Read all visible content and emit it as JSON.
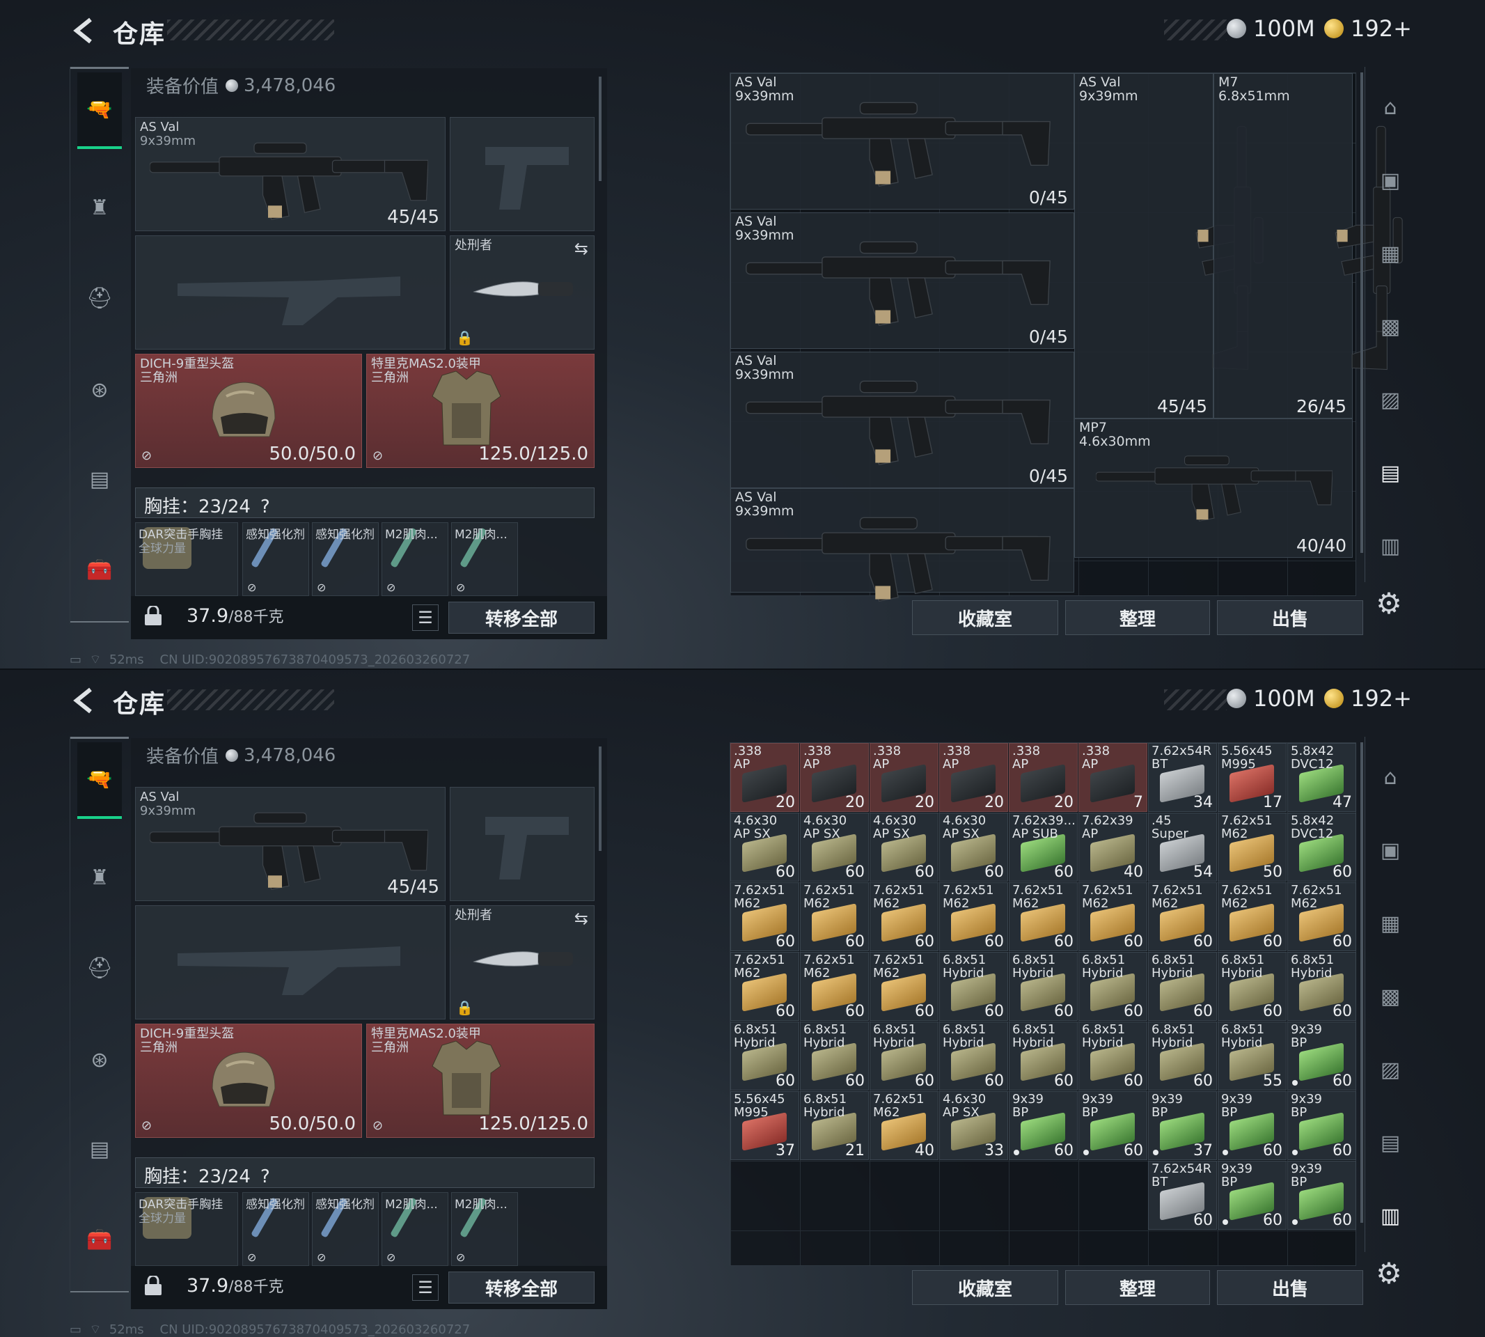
{
  "header": {
    "title": "仓库",
    "silver": "100M",
    "gold": "192+"
  },
  "status": {
    "ping": "52ms",
    "uid": "CN UID:9020895767387040957​3_202603260727"
  },
  "loadout": {
    "value_label": "装备价值",
    "value": "3,478,046",
    "primary": {
      "name": "AS Val",
      "caliber": "9x39mm",
      "ammo": "45/45"
    },
    "melee": {
      "name": "处刑者"
    },
    "helmet": {
      "name": "DICH-9重型头盔",
      "sub": "三角洲",
      "dur": "50.0/50.0"
    },
    "armor": {
      "name": "特里克MAS2.0装甲",
      "sub": "三角洲",
      "dur": "125.0/125.0"
    },
    "chest": {
      "label": "胸挂：23/24",
      "help": "?"
    },
    "chest_items": [
      "DAR突击手胸挂",
      "感知强化剂",
      "感知强化剂",
      "M2肌肉...",
      "M2肌肉..."
    ],
    "chest_item_sub": "全球力量",
    "weight": "37.9",
    "weight_max": "/88千克",
    "transfer_all": "转移全部"
  },
  "buttons": {
    "collection": "收藏室",
    "sort": "整理",
    "sell": "出售"
  },
  "stash1": [
    {
      "name": "AS Val",
      "cal": "9x39mm",
      "count": "0/45"
    },
    {
      "name": "AS Val",
      "cal": "9x39mm",
      "count": "0/45"
    },
    {
      "name": "AS Val",
      "cal": "9x39mm",
      "count": "0/45"
    },
    {
      "name": "AS Val",
      "cal": "9x39mm",
      "count": ""
    },
    {
      "name": "AS Val",
      "cal": "9x39mm",
      "count": "45/45"
    },
    {
      "name": "M7",
      "cal": "6.8x51mm",
      "count": "26/45"
    },
    {
      "name": "MP7",
      "cal": "4.6x30mm",
      "count": "40/40"
    }
  ],
  "ammo": [
    {
      "n1": ".338",
      "n2": "AP",
      "c": "20",
      "k": "dark",
      "red": true
    },
    {
      "n1": ".338",
      "n2": "AP",
      "c": "20",
      "k": "dark",
      "red": true
    },
    {
      "n1": ".338",
      "n2": "AP",
      "c": "20",
      "k": "dark",
      "red": true
    },
    {
      "n1": ".338",
      "n2": "AP",
      "c": "20",
      "k": "dark",
      "red": true
    },
    {
      "n1": ".338",
      "n2": "AP",
      "c": "20",
      "k": "dark",
      "red": true
    },
    {
      "n1": ".338",
      "n2": "AP",
      "c": "7",
      "k": "dark",
      "red": true
    },
    {
      "n1": "7.62x54R",
      "n2": "BT",
      "c": "34",
      "k": "grey"
    },
    {
      "n1": "5.56x45",
      "n2": "M995",
      "c": "17",
      "k": "redb"
    },
    {
      "n1": "5.8x42",
      "n2": "DVC12",
      "c": "47",
      "k": "green"
    },
    {
      "n1": "4.6x30",
      "n2": "AP SX",
      "c": "60",
      "k": "olive"
    },
    {
      "n1": "4.6x30",
      "n2": "AP SX",
      "c": "60",
      "k": "olive"
    },
    {
      "n1": "4.6x30",
      "n2": "AP SX",
      "c": "60",
      "k": "olive"
    },
    {
      "n1": "4.6x30",
      "n2": "AP SX",
      "c": "60",
      "k": "olive"
    },
    {
      "n1": "7.62x39...",
      "n2": "AP SUB",
      "c": "60",
      "k": "green"
    },
    {
      "n1": "7.62x39",
      "n2": "AP",
      "c": "40",
      "k": "olive"
    },
    {
      "n1": ".45",
      "n2": "Super",
      "c": "54",
      "k": "grey"
    },
    {
      "n1": "7.62x51",
      "n2": "M62",
      "c": "50",
      "k": "gold"
    },
    {
      "n1": "5.8x42",
      "n2": "DVC12",
      "c": "60",
      "k": "green"
    },
    {
      "n1": "7.62x51",
      "n2": "M62",
      "c": "60",
      "k": "gold"
    },
    {
      "n1": "7.62x51",
      "n2": "M62",
      "c": "60",
      "k": "gold"
    },
    {
      "n1": "7.62x51",
      "n2": "M62",
      "c": "60",
      "k": "gold"
    },
    {
      "n1": "7.62x51",
      "n2": "M62",
      "c": "60",
      "k": "gold"
    },
    {
      "n1": "7.62x51",
      "n2": "M62",
      "c": "60",
      "k": "gold"
    },
    {
      "n1": "7.62x51",
      "n2": "M62",
      "c": "60",
      "k": "gold"
    },
    {
      "n1": "7.62x51",
      "n2": "M62",
      "c": "60",
      "k": "gold"
    },
    {
      "n1": "7.62x51",
      "n2": "M62",
      "c": "60",
      "k": "gold"
    },
    {
      "n1": "7.62x51",
      "n2": "M62",
      "c": "60",
      "k": "gold"
    },
    {
      "n1": "7.62x51",
      "n2": "M62",
      "c": "60",
      "k": "gold"
    },
    {
      "n1": "7.62x51",
      "n2": "M62",
      "c": "60",
      "k": "gold"
    },
    {
      "n1": "7.62x51",
      "n2": "M62",
      "c": "60",
      "k": "gold"
    },
    {
      "n1": "6.8x51",
      "n2": "Hybrid",
      "c": "60",
      "k": "olive"
    },
    {
      "n1": "6.8x51",
      "n2": "Hybrid",
      "c": "60",
      "k": "olive"
    },
    {
      "n1": "6.8x51",
      "n2": "Hybrid",
      "c": "60",
      "k": "olive"
    },
    {
      "n1": "6.8x51",
      "n2": "Hybrid",
      "c": "60",
      "k": "olive"
    },
    {
      "n1": "6.8x51",
      "n2": "Hybrid",
      "c": "60",
      "k": "olive"
    },
    {
      "n1": "6.8x51",
      "n2": "Hybrid",
      "c": "60",
      "k": "olive"
    },
    {
      "n1": "6.8x51",
      "n2": "Hybrid",
      "c": "60",
      "k": "olive"
    },
    {
      "n1": "6.8x51",
      "n2": "Hybrid",
      "c": "60",
      "k": "olive"
    },
    {
      "n1": "6.8x51",
      "n2": "Hybrid",
      "c": "60",
      "k": "olive"
    },
    {
      "n1": "6.8x51",
      "n2": "Hybrid",
      "c": "60",
      "k": "olive"
    },
    {
      "n1": "6.8x51",
      "n2": "Hybrid",
      "c": "60",
      "k": "olive"
    },
    {
      "n1": "6.8x51",
      "n2": "Hybrid",
      "c": "60",
      "k": "olive"
    },
    {
      "n1": "6.8x51",
      "n2": "Hybrid",
      "c": "60",
      "k": "olive"
    },
    {
      "n1": "6.8x51",
      "n2": "Hybrid",
      "c": "55",
      "k": "olive"
    },
    {
      "n1": "9x39",
      "n2": "BP",
      "c": "60",
      "k": "green",
      "dot": true
    },
    {
      "n1": "5.56x45",
      "n2": "M995",
      "c": "37",
      "k": "redb"
    },
    {
      "n1": "6.8x51",
      "n2": "Hybrid",
      "c": "21",
      "k": "olive"
    },
    {
      "n1": "7.62x51",
      "n2": "M62",
      "c": "40",
      "k": "gold"
    },
    {
      "n1": "4.6x30",
      "n2": "AP SX",
      "c": "33",
      "k": "olive"
    },
    {
      "n1": "9x39",
      "n2": "BP",
      "c": "60",
      "k": "green",
      "dot": true
    },
    {
      "n1": "9x39",
      "n2": "BP",
      "c": "60",
      "k": "green",
      "dot": true
    },
    {
      "n1": "9x39",
      "n2": "BP",
      "c": "37",
      "k": "green",
      "dot": true
    },
    {
      "n1": "9x39",
      "n2": "BP",
      "c": "60",
      "k": "green",
      "dot": true
    },
    {
      "n1": "9x39",
      "n2": "BP",
      "c": "60",
      "k": "green",
      "dot": true
    },
    {
      "n1": "7.62x54R",
      "n2": "BT",
      "c": "60",
      "k": "grey"
    },
    {
      "n1": "9x39",
      "n2": "BP",
      "c": "60",
      "k": "green",
      "dot": true
    },
    {
      "n1": "9x39",
      "n2": "BP",
      "c": "60",
      "k": "green",
      "dot": true
    }
  ]
}
